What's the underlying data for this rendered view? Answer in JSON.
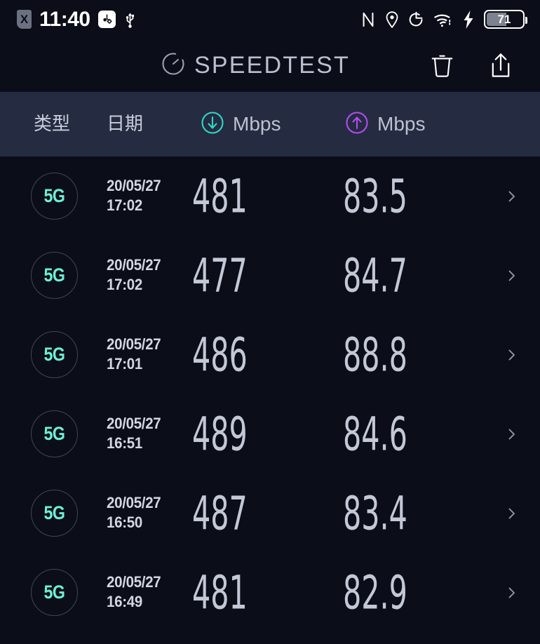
{
  "status_bar": {
    "sim_icon_label": "X",
    "time": "11:40",
    "usb_debug_icon": "usb-debugging-icon",
    "usb_icon": "usb-icon",
    "nfc_icon": "nfc-icon",
    "location_icon": "location-pin-icon",
    "rotation_icon": "screen-rotation-icon",
    "wifi_icon": "wifi-icon",
    "charging_icon": "charging-bolt-icon",
    "battery_percent": "71"
  },
  "header": {
    "brand_title": "SPEEDTEST",
    "brand_icon": "speedometer-icon",
    "delete_label": "delete-icon",
    "share_label": "share-icon"
  },
  "columns": {
    "type": "类型",
    "date": "日期",
    "download": "Mbps",
    "upload": "Mbps",
    "download_icon": "download-arrow-icon",
    "upload_icon": "upload-arrow-icon"
  },
  "colors": {
    "page_bg": "#0b0e18",
    "header_band_bg": "#252b41",
    "download_accent": "#2ed9c3",
    "upload_accent": "#b44df0",
    "badge_text": "#6ef0d4",
    "metric_text": "#c3c8d6"
  },
  "results": [
    {
      "network": "5G",
      "date": "20/05/27",
      "time": "17:02",
      "download": "481",
      "upload": "83.5",
      "chevron": "chevron-right-icon"
    },
    {
      "network": "5G",
      "date": "20/05/27",
      "time": "17:02",
      "download": "477",
      "upload": "84.7",
      "chevron": "chevron-right-icon"
    },
    {
      "network": "5G",
      "date": "20/05/27",
      "time": "17:01",
      "download": "486",
      "upload": "88.8",
      "chevron": "chevron-right-icon"
    },
    {
      "network": "5G",
      "date": "20/05/27",
      "time": "16:51",
      "download": "489",
      "upload": "84.6",
      "chevron": "chevron-right-icon"
    },
    {
      "network": "5G",
      "date": "20/05/27",
      "time": "16:50",
      "download": "487",
      "upload": "83.4",
      "chevron": "chevron-right-icon"
    },
    {
      "network": "5G",
      "date": "20/05/27",
      "time": "16:49",
      "download": "481",
      "upload": "82.9",
      "chevron": "chevron-right-icon"
    }
  ]
}
